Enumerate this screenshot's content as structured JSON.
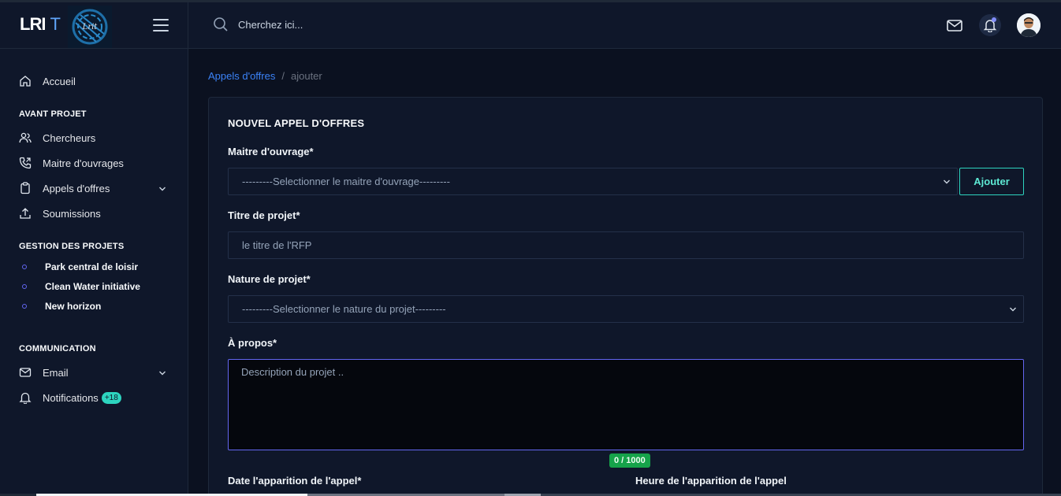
{
  "brand": {
    "name": "LRI",
    "suffix": "T",
    "logo_text": "Lrit"
  },
  "search": {
    "placeholder": "Cherchez ici..."
  },
  "sidebar": {
    "home": "Accueil",
    "sections": [
      {
        "title": "AVANT PROJET",
        "items": [
          "Chercheurs",
          "Maitre d'ouvrages",
          "Appels d'offres",
          "Soumissions"
        ]
      },
      {
        "title": "GESTION DES PROJETS",
        "items": [
          "Park central de loisir",
          "Clean Water initiative",
          "New horizon"
        ]
      },
      {
        "title": "COMMUNICATION",
        "items": [
          "Email",
          "Notifications"
        ]
      }
    ],
    "notifications_badge": "+18"
  },
  "breadcrumb": {
    "link": "Appels d'offres",
    "separator": "/",
    "current": "ajouter"
  },
  "form": {
    "title": "NOUVEL APPEL D'OFFRES",
    "owner_label": "Maitre d'ouvrage*",
    "owner_select": "---------Selectionner le maitre d'ouvrage---------",
    "add_button": "Ajouter",
    "title_label": "Titre de projet*",
    "title_placeholder": "le titre de l'RFP",
    "nature_label": "Nature de projet*",
    "nature_select": "---------Selectionner le nature du projet---------",
    "about_label": "À propos*",
    "about_placeholder": "Description du projet ..",
    "counter": "0 / 1000",
    "date_label": "Date l'apparition de l'appel*",
    "time_label": "Heure de l'apparition de l'appel"
  },
  "colors": {
    "accent": "#3b82f6",
    "teal": "#2dd4bf",
    "indigo": "#6366f1",
    "success": "#16a34a"
  }
}
